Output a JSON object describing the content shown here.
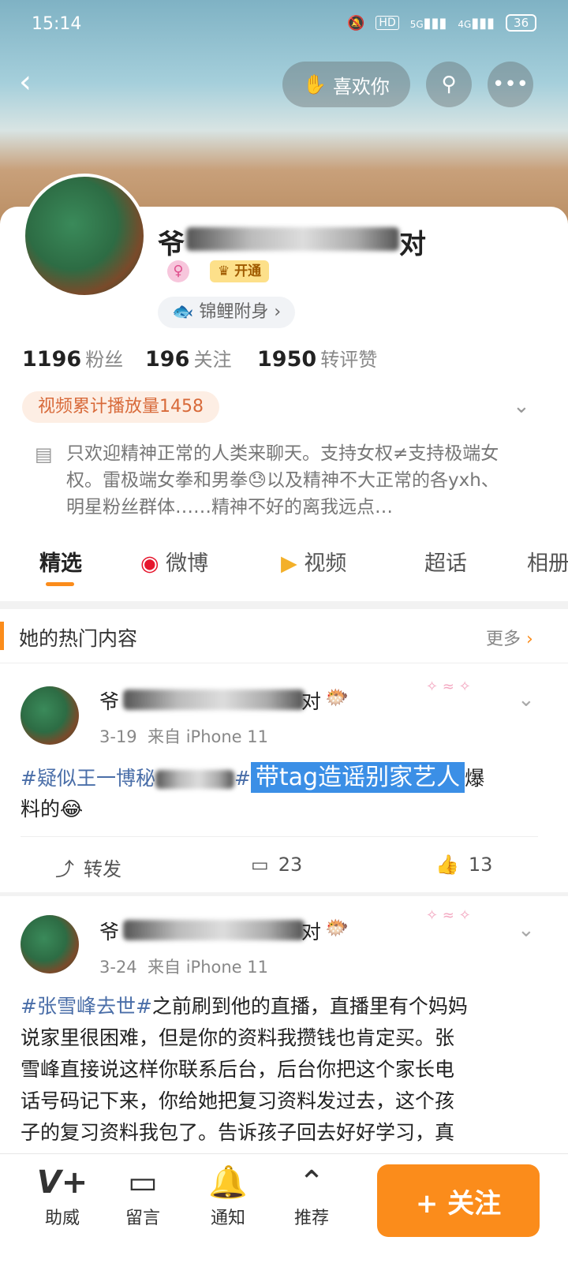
{
  "status_bar": {
    "time": "15:14",
    "battery": "36",
    "signal_1": "5G",
    "signal_2": "4G",
    "hd": "HD"
  },
  "header": {
    "like_label": "喜欢你"
  },
  "profile": {
    "name_visible_start": "爷",
    "name_visible_end": "对",
    "vip_label": "开通",
    "koi_label": "锦鲤附身",
    "followers_count": "1196",
    "followers_label": "粉丝",
    "following_count": "196",
    "following_label": "关注",
    "interactions_count": "1950",
    "interactions_label": "转评赞",
    "video_plays": "视频累计播放量1458",
    "bio": "只欢迎精神正常的人类来聊天。支持女权≠支持极端女权。雷极端女拳和男拳😓以及精神不大正常的各yxh、明星粉丝群体……精神不好的离我远点…"
  },
  "tabs": [
    {
      "label": "精选",
      "active": true
    },
    {
      "label": "微博"
    },
    {
      "label": "视频"
    },
    {
      "label": "超话"
    },
    {
      "label": "相册"
    }
  ],
  "hot_section": {
    "title": "她的热门内容",
    "more_label": "更多"
  },
  "posts": [
    {
      "name_start": "爷",
      "name_end": "对",
      "date": "3-19",
      "source": "来自 iPhone 11",
      "tag": "#疑似王一博秘",
      "tag_end": "#",
      "highlight": "带tag造谣别家艺人",
      "tail": "爆",
      "line2": "料的😂",
      "repost_label": "转发",
      "comments": "23",
      "likes": "13"
    },
    {
      "name_start": "爷",
      "name_end": "对",
      "date": "3-24",
      "source": "来自 iPhone 11",
      "tag": "#张雪峰去世#",
      "line1_rest": "之前刷到他的直播，直播里有个妈妈",
      "line2": "说家里很困难，但是你的资料我攒钱也肯定买。张",
      "line3": "雪峰直接说这样你联系后台，后台你把这个家长电",
      "line4": "话号码记下来，你给她把复习资料发过去，这个孩",
      "line5": "子的复习资料我包了。告诉孩子回去好好学习，真"
    }
  ],
  "bottom_bar": {
    "items": [
      {
        "label": "助威",
        "icon": "V+"
      },
      {
        "label": "留言",
        "icon": "▭"
      },
      {
        "label": "通知",
        "icon": "🔔"
      },
      {
        "label": "推荐",
        "icon": "⌃"
      }
    ],
    "follow_label": "+ 关注"
  },
  "colors": {
    "accent": "#fb8c1b",
    "link": "#4a6ea8",
    "highlight": "#3b8fe6"
  }
}
